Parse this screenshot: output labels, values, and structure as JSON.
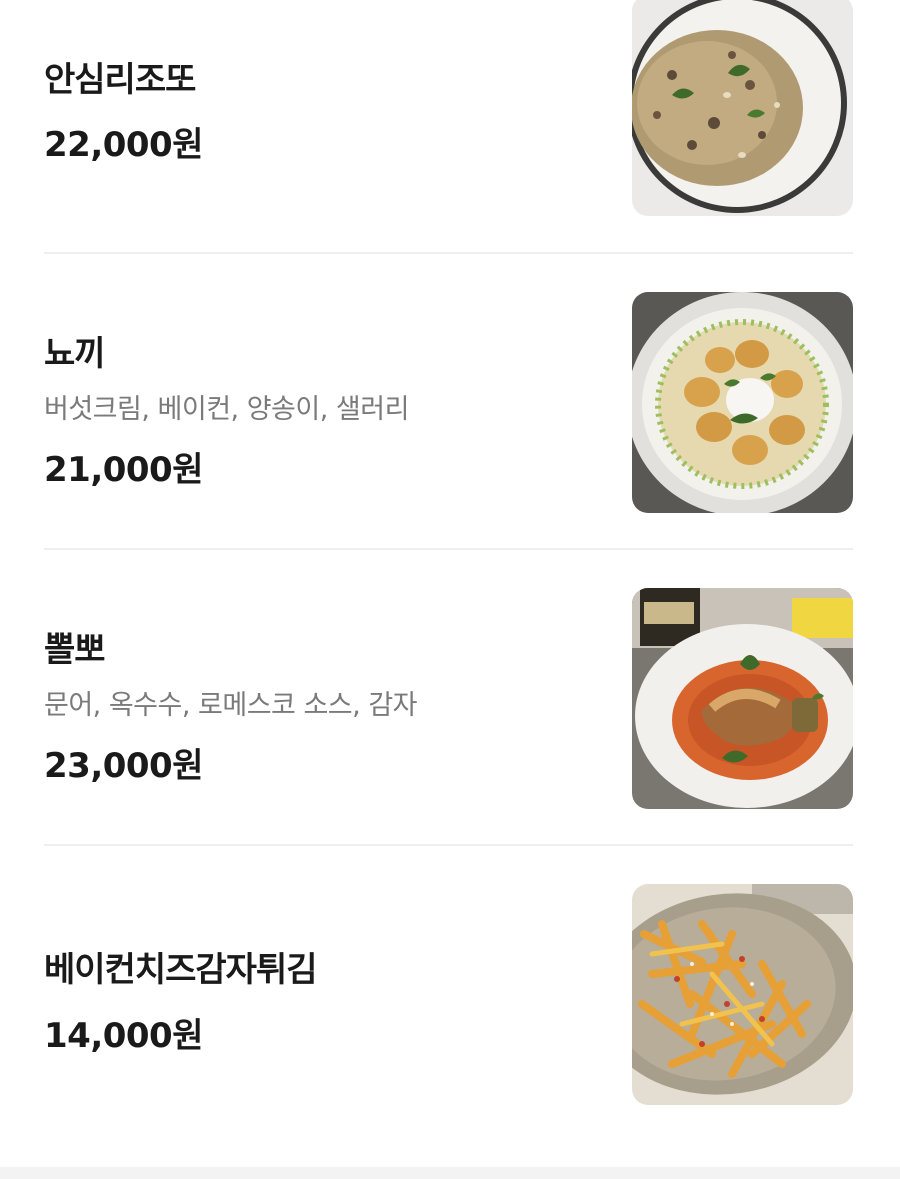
{
  "menu": {
    "items": [
      {
        "name": "안심리조또",
        "description": "",
        "price": "22,000원",
        "photo": "risotto-photo"
      },
      {
        "name": "뇨끼",
        "description": "버섯크림, 베이컨, 양송이, 샐러리",
        "price": "21,000원",
        "photo": "gnocchi-photo"
      },
      {
        "name": "뽈뽀",
        "description": "문어, 옥수수, 로메스코 소스, 감자",
        "price": "23,000원",
        "photo": "polpo-photo"
      },
      {
        "name": "베이컨치즈감자튀김",
        "description": "",
        "price": "14,000원",
        "photo": "bacon-cheese-fries-photo"
      }
    ]
  },
  "colors": {
    "text_primary": "#1a1a1a",
    "text_secondary": "#7a7a7a",
    "divider": "#efefef",
    "background": "#ffffff"
  }
}
